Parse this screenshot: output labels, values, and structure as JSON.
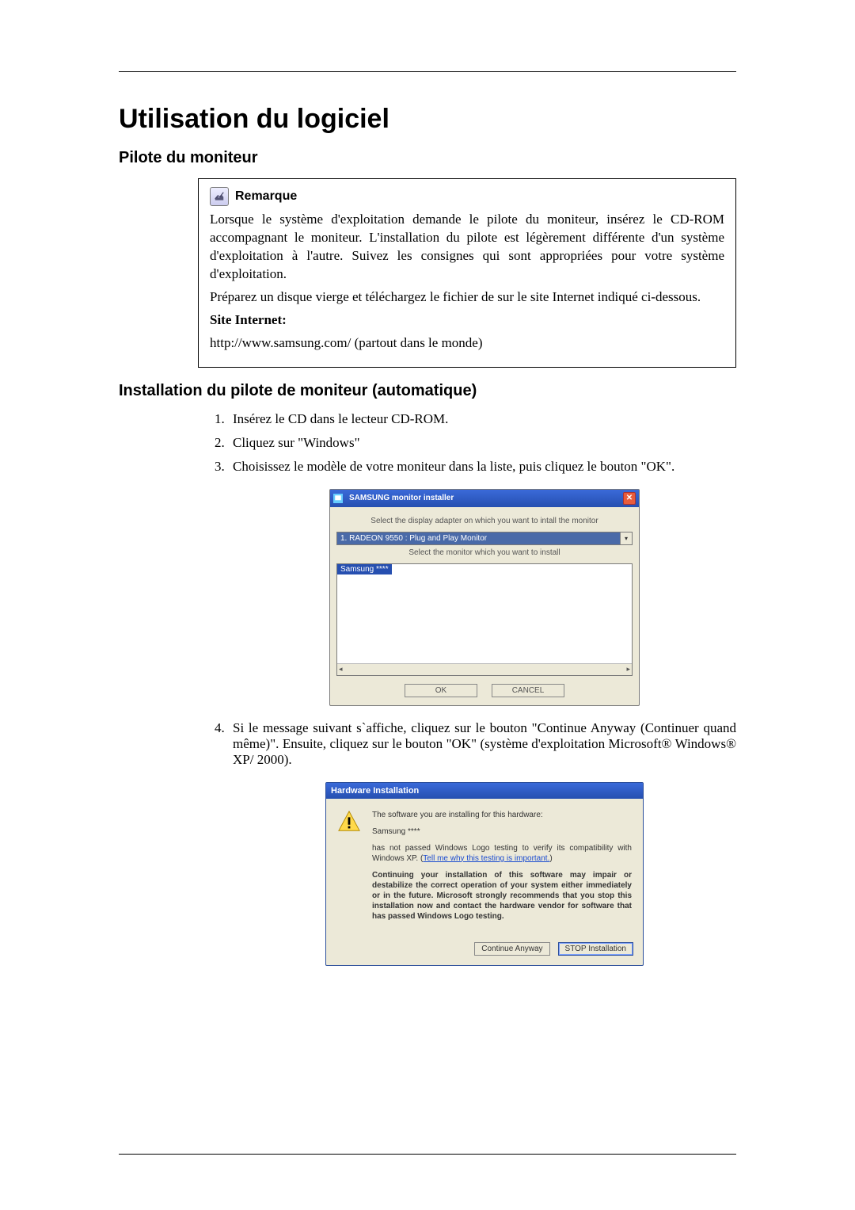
{
  "title": "Utilisation du logiciel",
  "section1": "Pilote du moniteur",
  "note": {
    "label": "Remarque",
    "p1": "Lorsque le système d'exploitation demande le pilote du moniteur, insérez le CD-ROM accompagnant le moniteur. L'installation du pilote est légèrement différente d'un système d'exploitation à l'autre. Suivez les consignes qui sont appropriées pour votre système d'exploitation.",
    "p2": "Préparez un disque vierge et téléchargez le fichier de sur le site Internet indiqué ci-dessous.",
    "site_label": "Site Internet:",
    "site_url": "http://www.samsung.com/ (partout dans le monde)"
  },
  "section2": "Installation du pilote de moniteur (automatique)",
  "steps": {
    "s1": "Insérez le CD dans le lecteur CD-ROM.",
    "s2": "Cliquez sur \"Windows\"",
    "s3": "Choisissez le modèle de votre moniteur dans la liste, puis cliquez le bouton \"OK\".",
    "s4": "Si le message suivant s`affiche, cliquez sur le bouton \"Continue Anyway (Continuer quand même)\". Ensuite, cliquez sur le bouton \"OK\" (système d'exploitation Microsoft® Windows® XP/ 2000)."
  },
  "dlg1": {
    "title": "SAMSUNG monitor installer",
    "line1": "Select the display adapter on which you want to intall the monitor",
    "combo": "1. RADEON 9550 : Plug and Play Monitor",
    "line2": "Select the monitor which you want to install",
    "list_selected": "Samsung ****",
    "btn_ok": "OK",
    "btn_cancel": "CANCEL"
  },
  "dlg2": {
    "title": "Hardware Installation",
    "p1": "The software you are installing for this hardware:",
    "hw": "Samsung ****",
    "p2a": "has not passed Windows Logo testing to verify its compatibility with Windows XP. (",
    "link": "Tell me why this testing is important.",
    "p2b": ")",
    "p3": "Continuing your installation of this software may impair or destabilize the correct operation of your system either immediately or in the future. Microsoft strongly recommends that you stop this installation now and contact the hardware vendor for software that has passed Windows Logo testing.",
    "btn_continue": "Continue Anyway",
    "btn_stop": "STOP Installation"
  }
}
